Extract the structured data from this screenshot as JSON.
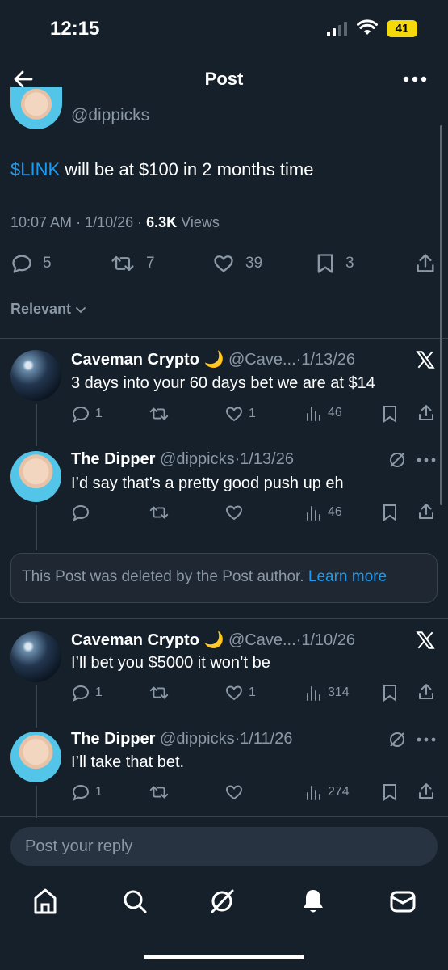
{
  "status_bar": {
    "time": "12:15",
    "battery": "41"
  },
  "header": {
    "title": "Post"
  },
  "post": {
    "handle": "@dippicks",
    "ticker": "$LINK",
    "text": " will be at $100 in 2 months time",
    "time": "10:07 AM",
    "date": "1/10/26",
    "views_count": "6.3K",
    "views_label": " Views",
    "stats": {
      "replies": "5",
      "reposts": "7",
      "likes": "39",
      "bookmarks": "3"
    }
  },
  "sort": {
    "label": "Relevant"
  },
  "replies": [
    {
      "name": "Caveman Crypto",
      "emoji": "🌙",
      "handle": "@Cave...",
      "date": "1/13/26",
      "text": "3 days into your 60 days bet we are at $14",
      "replies": "1",
      "likes": "1",
      "views": "46"
    },
    {
      "name": "The Dipper",
      "handle": "@dippicks",
      "date": "1/13/26",
      "text": "I’d say that’s a pretty good push up eh",
      "views": "46"
    },
    {
      "name": "Caveman Crypto",
      "emoji": "🌙",
      "handle": "@Cave...",
      "date": "1/10/26",
      "text": "I’ll bet you $5000 it won’t be",
      "replies": "1",
      "likes": "1",
      "views": "314"
    },
    {
      "name": "The Dipper",
      "handle": "@dippicks",
      "date": "1/11/26",
      "text": "I’ll take that bet.",
      "replies": "1",
      "views": "274"
    }
  ],
  "deleted": {
    "text": "This Post was deleted by the Post author. ",
    "link": "Learn more"
  },
  "reply_input": {
    "placeholder": "Post your reply"
  },
  "colors": {
    "background": "#15202b",
    "accent": "#1d9bf0",
    "muted": "#8b98a5",
    "divider": "#38444d"
  }
}
